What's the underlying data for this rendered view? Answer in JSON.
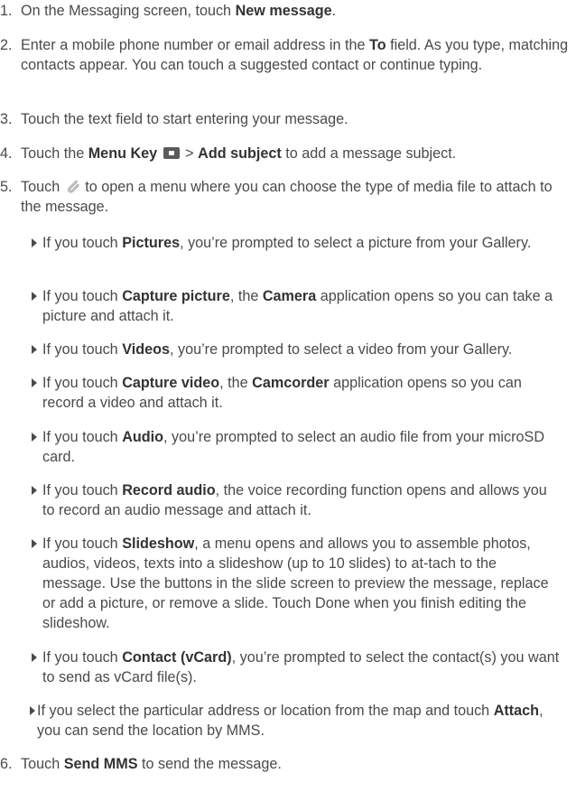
{
  "steps": [
    {
      "num": "1.",
      "segments": [
        "On the Messaging screen, touch ",
        "New message",
        "."
      ]
    },
    {
      "num": "2.",
      "segments": [
        "Enter a mobile phone number or email address in the ",
        "To",
        " field. As you type, matching contacts appear. You can touch a suggested contact or continue typing."
      ]
    },
    {
      "num": "3.",
      "segments": [
        "Touch the text field to start entering your message."
      ]
    },
    {
      "num": "4.",
      "segments": [
        "Touch the ",
        "Menu Key",
        " > ",
        "Add subject",
        " to add a message subject."
      ]
    },
    {
      "num": "5.",
      "segments": [
        "Touch ",
        " to open a menu where you can choose the type of media file to attach to the message."
      ]
    },
    {
      "num": "6.",
      "segments": [
        "Touch ",
        "Send MMS",
        " to send the message."
      ]
    }
  ],
  "bullets": [
    {
      "segments": [
        "If you touch ",
        "Pictures",
        ", you’re prompted to select a picture from your Gallery."
      ]
    },
    {
      "segments": [
        "If you touch ",
        "Capture picture",
        ", the ",
        "Camera",
        " application opens so you can take a picture and attach it."
      ]
    },
    {
      "segments": [
        "If you touch ",
        "Videos",
        ", you’re prompted to select a video from your Gallery."
      ]
    },
    {
      "segments": [
        "If you touch ",
        "Capture video",
        ", the ",
        "Camcorder",
        " application opens so you can record a video and attach it."
      ]
    },
    {
      "segments": [
        "If you touch ",
        "Audio",
        ", you’re prompted to select an audio file from your microSD card."
      ]
    },
    {
      "segments": [
        "If you touch ",
        "Record audio",
        ", the voice recording function opens and allows you to record an audio message and attach it."
      ]
    },
    {
      "segments": [
        "If you touch ",
        "Slideshow",
        ", a menu opens and allows you to assemble photos, audios, videos, texts into a slideshow (up to 10 slides) to at-",
        "tach to the message. Use the buttons in the slide screen to preview the message, replace or add a picture, or remove a slide. Touch Done when you finish editing the slideshow."
      ]
    },
    {
      "segments": [
        "If you touch ",
        "Contact (vCard)",
        ", you’re prompted to select the contact(s) you want to send as vCard file(s)."
      ]
    },
    {
      "segments": [
        "If you select the particular address or location from the map and touch ",
        "Attach",
        ",  you can send the location by MMS."
      ]
    }
  ],
  "icons": {
    "menu_key": "menu-key-icon",
    "attach": "paperclip-icon"
  }
}
